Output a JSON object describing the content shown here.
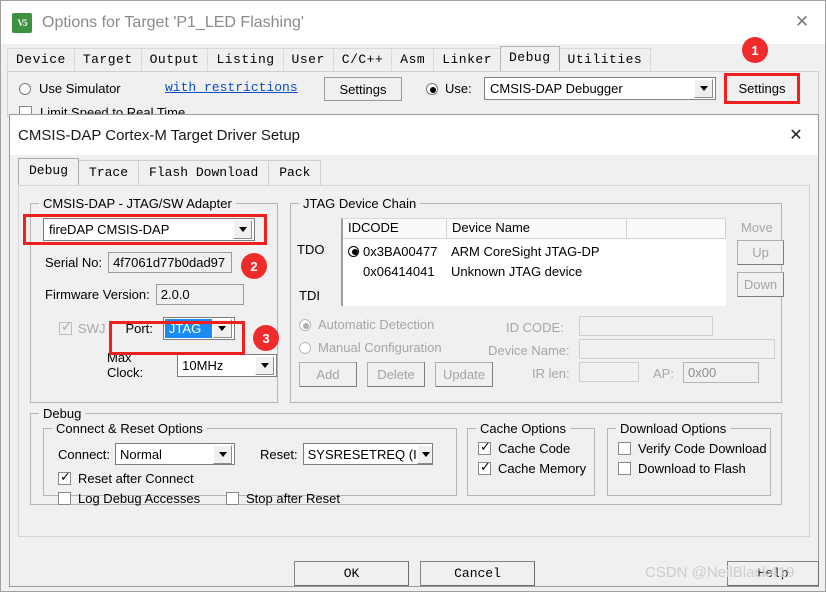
{
  "outer": {
    "title": "Options for Target 'P1_LED Flashing'",
    "app_icon": "keil-uvision-icon",
    "close_label": "✕",
    "tabs": [
      {
        "label": "Device",
        "selected": false
      },
      {
        "label": "Target",
        "selected": false
      },
      {
        "label": "Output",
        "selected": false
      },
      {
        "label": "Listing",
        "selected": false
      },
      {
        "label": "User",
        "selected": false
      },
      {
        "label": "C/C++",
        "selected": false
      },
      {
        "label": "Asm",
        "selected": false
      },
      {
        "label": "Linker",
        "selected": false
      },
      {
        "label": "Debug",
        "selected": true
      },
      {
        "label": "Utilities",
        "selected": false
      }
    ],
    "use_simulator_label": "Use Simulator",
    "with_restrictions_label": "with restrictions",
    "simulator_settings_label": "Settings",
    "limit_speed_label": "Limit Speed to Real Time",
    "use_label": "Use:",
    "debugger_value": "CMSIS-DAP Debugger",
    "debugger_settings_label": "Settings"
  },
  "inner": {
    "title": "CMSIS-DAP Cortex-M Target Driver Setup",
    "close_label": "✕",
    "tabs": [
      {
        "label": "Debug",
        "selected": true
      },
      {
        "label": "Trace",
        "selected": false
      },
      {
        "label": "Flash Download",
        "selected": false
      },
      {
        "label": "Pack",
        "selected": false
      }
    ],
    "adapter": {
      "group_title": "CMSIS-DAP - JTAG/SW Adapter",
      "adapter_value": "fireDAP CMSIS-DAP",
      "serial_label": "Serial No:",
      "serial_value": "4f7061d77b0dad97",
      "firmware_label": "Firmware Version:",
      "firmware_value": "2.0.0",
      "swj_label": "SWJ",
      "port_label": "Port:",
      "port_value": "JTAG",
      "max_clock_label": "Max Clock:",
      "max_clock_value": "10MHz"
    },
    "chain": {
      "group_title": "JTAG Device Chain",
      "columns": [
        "IDCODE",
        "Device Name",
        ""
      ],
      "rows": [
        {
          "idcode": "0x3BA00477",
          "device_name": "ARM CoreSight JTAG-DP",
          "selected": true
        },
        {
          "idcode": "0x06414041",
          "device_name": "Unknown JTAG device",
          "selected": false
        }
      ],
      "tdo_label": "TDO",
      "tdi_label": "TDI",
      "move_label": "Move",
      "up_label": "Up",
      "down_label": "Down",
      "automatic_detection_label": "Automatic Detection",
      "manual_configuration_label": "Manual Configuration",
      "add_label": "Add",
      "delete_label": "Delete",
      "update_label": "Update",
      "idcode_label": "ID CODE:",
      "idcode_value": "",
      "device_name_label": "Device Name:",
      "device_name_value": "",
      "irlen_label": "IR len:",
      "irlen_value": "",
      "ap_label": "AP:",
      "ap_value": "0x00"
    },
    "debug": {
      "group_title": "Debug",
      "connect_group_title": "Connect & Reset Options",
      "connect_label": "Connect:",
      "connect_value": "Normal",
      "reset_label": "Reset:",
      "reset_value": "SYSRESETREQ (I",
      "reset_after_connect_label": "Reset after Connect",
      "log_debug_accesses_label": "Log Debug Accesses",
      "stop_after_reset_label": "Stop after Reset",
      "cache_group_title": "Cache Options",
      "cache_code_label": "Cache Code",
      "cache_memory_label": "Cache Memory",
      "download_group_title": "Download Options",
      "verify_code_download_label": "Verify Code Download",
      "download_to_flash_label": "Download to Flash"
    }
  },
  "footer": {
    "ok_label": "OK",
    "cancel_label": "Cancel",
    "help_label": "Help"
  },
  "annotations": {
    "badge1": "1",
    "badge2": "2",
    "badge3": "3",
    "accent_color": "#ef2b2b"
  },
  "watermark": "CSDN @NeilBlack419"
}
